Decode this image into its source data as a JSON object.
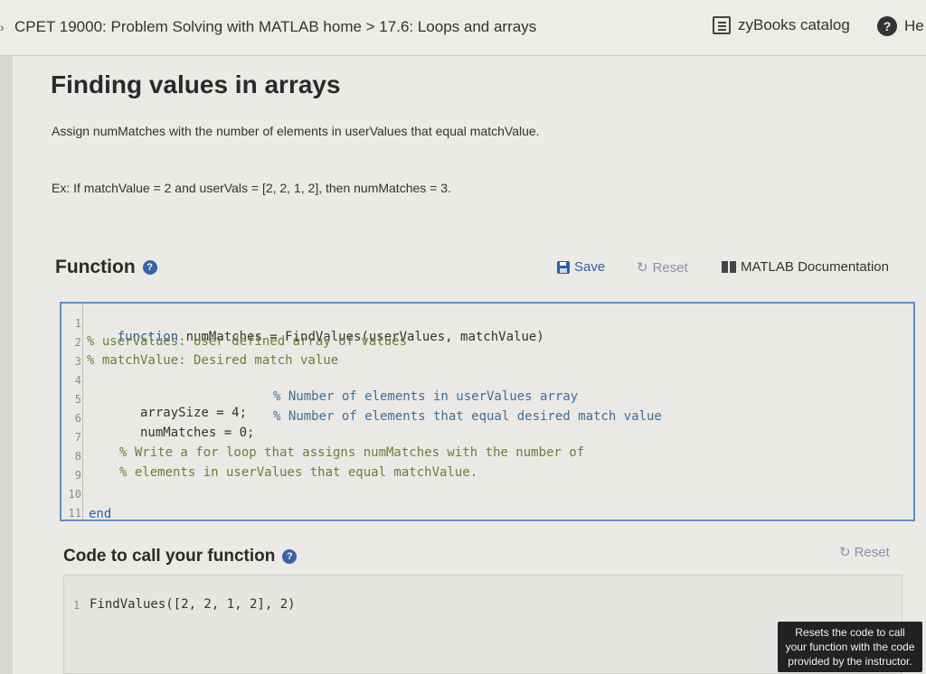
{
  "header": {
    "breadcrumb": "CPET 19000: Problem Solving with MATLAB home > 17.6: Loops and arrays",
    "catalog_label": "zyBooks catalog",
    "help_label": "He"
  },
  "activity": {
    "title": "Finding values in arrays",
    "instruction": "Assign numMatches with the number of elements in userValues that equal matchValue.",
    "example": "Ex: If matchValue = 2 and userVals = [2, 2, 1, 2], then numMatches = 3."
  },
  "function_section": {
    "title": "Function",
    "save_label": "Save",
    "reset_label": "Reset",
    "doc_label": "MATLAB Documentation",
    "code_lines": [
      {
        "num": "1",
        "kw": "function",
        "text": " numMatches = FindValues(userValues, matchValue)"
      },
      {
        "num": "2",
        "comment": "% userValues: User defined array of values"
      },
      {
        "num": "3",
        "comment": "% matchValue: Desired match value"
      },
      {
        "num": "4"
      },
      {
        "num": "5",
        "text": "   arraySize = 4;",
        "comment": "% Number of elements in userValues array"
      },
      {
        "num": "6",
        "text": "   numMatches = 0;",
        "comment": "% Number of elements that equal desired match value"
      },
      {
        "num": "7"
      },
      {
        "num": "8",
        "comment": "% Write a for loop that assigns numMatches with the number of"
      },
      {
        "num": "9",
        "comment": "% elements in userValues that equal matchValue."
      },
      {
        "num": "10"
      },
      {
        "num": "11",
        "kw": "end"
      }
    ]
  },
  "call_section": {
    "title": "Code to call your function",
    "reset_label": "Reset",
    "line_num": "1",
    "code": "FindValues([2, 2, 1, 2], 2)",
    "tooltip": "Resets the code to call your function with the code provided by the instructor."
  }
}
